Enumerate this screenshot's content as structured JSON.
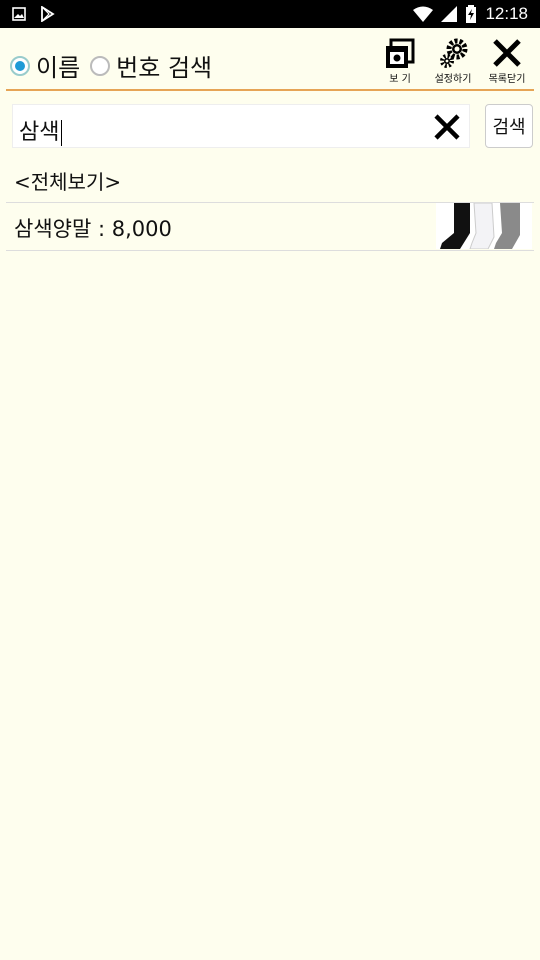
{
  "status_bar": {
    "time": "12:18",
    "icons": [
      "image-icon",
      "play-store-icon",
      "wifi-icon",
      "signal-icon",
      "battery-icon"
    ]
  },
  "search_mode": {
    "options": [
      {
        "label": "이름",
        "selected": true
      },
      {
        "label": "번호 검색",
        "selected": false
      }
    ]
  },
  "toolbar": {
    "view_label": "보 기",
    "settings_label": "설정하기",
    "close_list_label": "목록닫기"
  },
  "search": {
    "value": "삼색",
    "button_label": "검색"
  },
  "list": {
    "show_all_label": "<전체보기>",
    "items": [
      {
        "text": "삼색양말 : 8,000",
        "thumbnail": "socks-image"
      }
    ]
  },
  "colors": {
    "background": "#fefeee",
    "accent_divider": "#e6a455",
    "radio_selected": "#1e9ad6"
  }
}
